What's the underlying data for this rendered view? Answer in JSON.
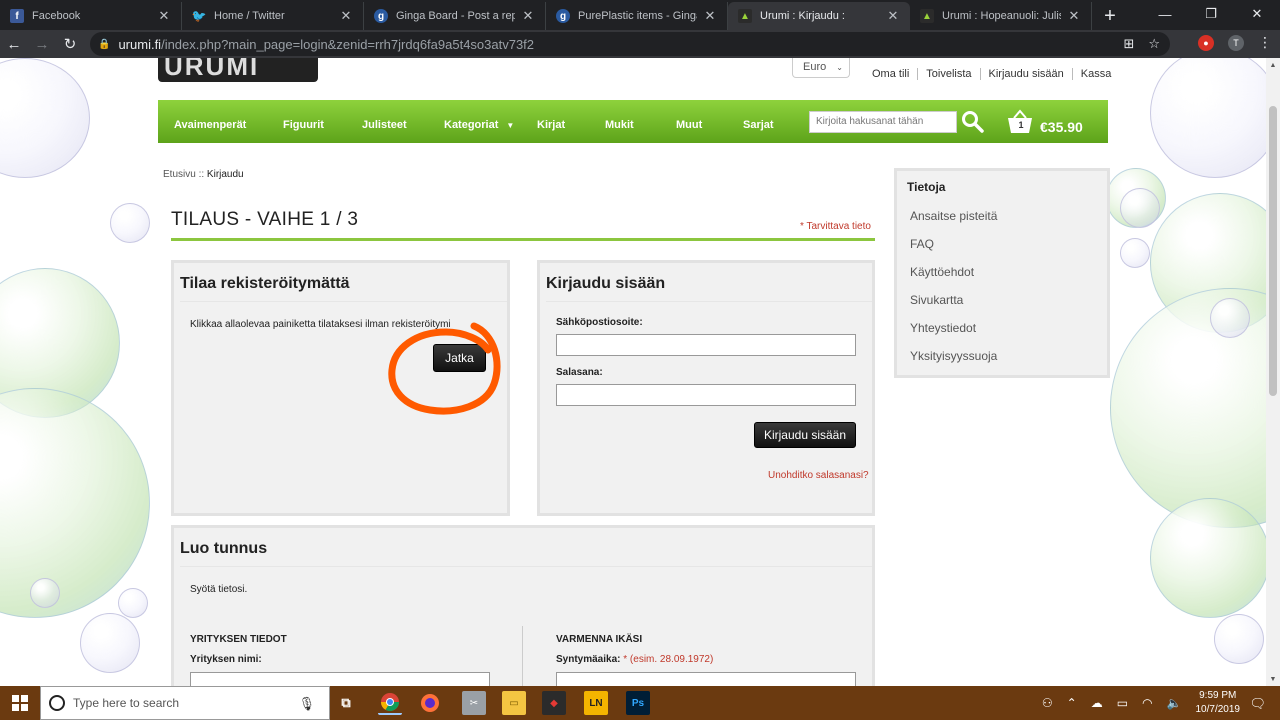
{
  "browser": {
    "tabs": [
      {
        "title": "Facebook",
        "icon": "facebook-icon",
        "color": "#3b5998",
        "glyph": "f"
      },
      {
        "title": "Home / Twitter",
        "icon": "twitter-icon",
        "color": "#1da1f2",
        "glyph": "t"
      },
      {
        "title": "Ginga Board - Post a reply",
        "icon": "ginga-icon",
        "color": "#2a5aa0",
        "glyph": "g"
      },
      {
        "title": "PurePlastic items - Ginga Bo",
        "icon": "ginga-icon",
        "color": "#2a5aa0",
        "glyph": "g"
      },
      {
        "title": "Urumi : Kirjaudu :",
        "icon": "urumi-icon",
        "color": "#2b2b2b",
        "glyph": "A"
      },
      {
        "title": "Urumi : Hopeanuoli: Juliste: H",
        "icon": "urumi-icon",
        "color": "#2b2b2b",
        "glyph": "A"
      }
    ],
    "active_tab": 4,
    "url_host": "urumi.fi",
    "url_path": "/index.php?main_page=login&zenid=rrh7jrdq6fa9a5t4so3atv73f2",
    "profile_initial": "T"
  },
  "site": {
    "logo_text": "URUMI",
    "currency": "Euro",
    "toplinks": [
      "Oma tili",
      "Toivelista",
      "Kirjaudu sisään",
      "Kassa"
    ],
    "nav": [
      "Avaimenperät",
      "Figuurit",
      "Julisteet",
      "Kategoriat",
      "Kirjat",
      "Mukit",
      "Muut",
      "Sarjat"
    ],
    "search_placeholder": "Kirjoita hakusanat tähän",
    "cart_count": "1",
    "cart_total": "€35.90",
    "accent": "#8cc63f"
  },
  "breadcrumb": {
    "home": "Etusivu ::",
    "current": "Kirjaudu"
  },
  "page": {
    "title": "TILAUS - VAIHE 1 / 3",
    "required_note": "* Tarvittava tieto"
  },
  "guest": {
    "heading": "Tilaa rekisteröitymättä",
    "text": "Klikkaa allaolevaa painiketta tilataksesi ilman rekisteröitymistä.",
    "button": "Jatka"
  },
  "login": {
    "heading": "Kirjaudu sisään",
    "email_label": "Sähköpostiosoite:",
    "password_label": "Salasana:",
    "button": "Kirjaudu sisään",
    "forgot": "Unohditko salasanasi?"
  },
  "create": {
    "heading": "Luo tunnus",
    "intro": "Syötä tietosi.",
    "company_heading": "YRITYKSEN TIEDOT",
    "company_label": "Yrityksen nimi:",
    "age_heading": "VARMENNA IKÄSI",
    "birth_label": "Syntymäaika:",
    "birth_hint": "* (esim. 28.09.1972)"
  },
  "sidebar": {
    "heading": "Tietoja",
    "items": [
      "Ansaitse pisteitä",
      "FAQ",
      "Käyttöehdot",
      "Sivukartta",
      "Yhteystiedot",
      "Yksityisyyssuoja"
    ]
  },
  "taskbar": {
    "search_placeholder": "Type here to search",
    "time": "9:59 PM",
    "date": "10/7/2019",
    "apps": [
      "chrome-icon",
      "firefox-icon",
      "snip-icon",
      "file-explorer-icon",
      "game-icon",
      "ln-icon",
      "photoshop-icon"
    ],
    "ln_label": "LN",
    "ps_label": "Ps"
  }
}
